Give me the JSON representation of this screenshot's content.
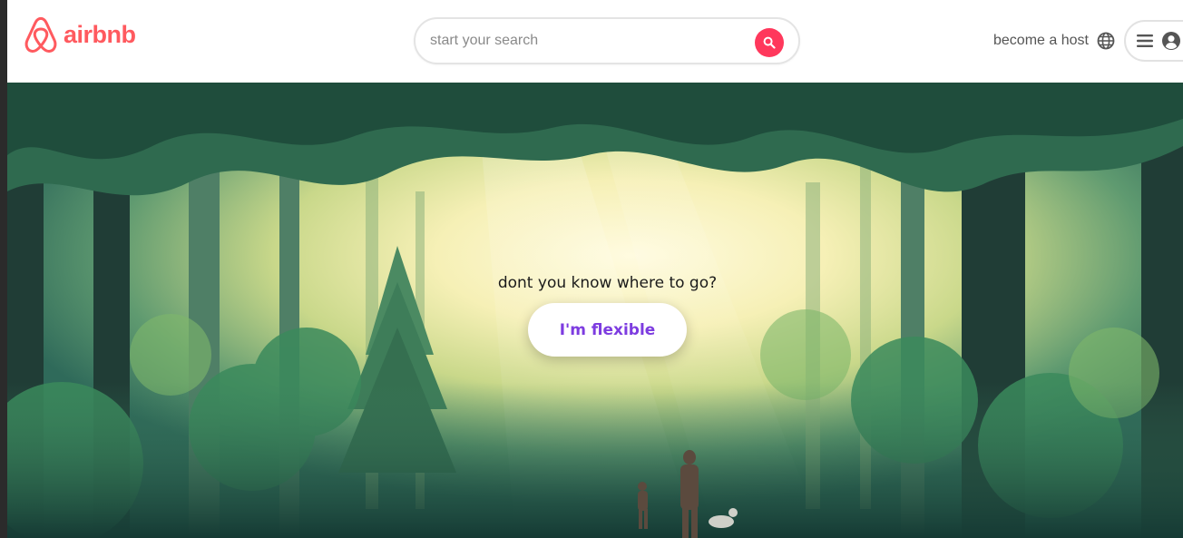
{
  "header": {
    "brand": "airbnb",
    "search": {
      "placeholder": "start your search"
    },
    "host_link": "become a host"
  },
  "hero": {
    "prompt": "dont you know where to go?",
    "cta_label": "I'm flexible"
  },
  "icons": {
    "logo": "airbnb-belo-logo",
    "search": "search-icon",
    "globe": "globe-icon",
    "menu": "hamburger-menu-icon",
    "account": "user-circle-icon"
  },
  "colors": {
    "brand": "#ff5a5f",
    "search_button": "#ff385c",
    "cta_text": "#7d3ce0"
  }
}
